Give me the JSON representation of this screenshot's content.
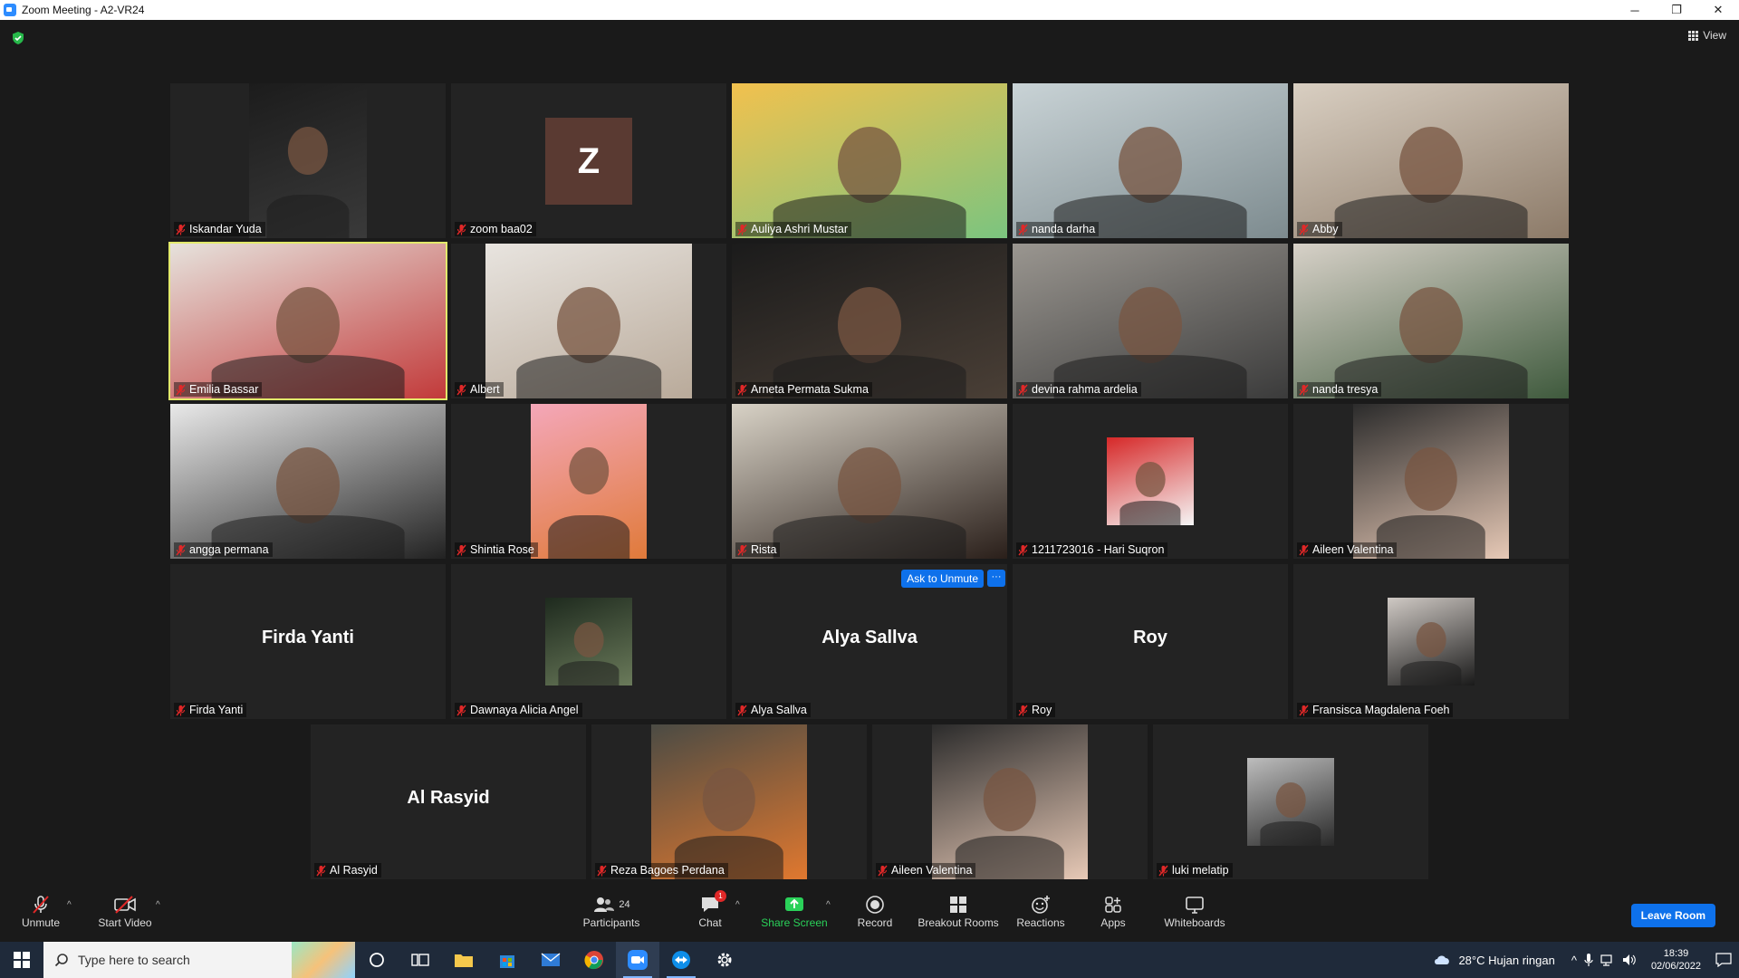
{
  "window": {
    "title": "Zoom Meeting - A2-VR24",
    "minimize": "─",
    "restore": "❐",
    "close": "✕"
  },
  "view_label": "View",
  "tiles": [
    {
      "name": "Iskandar Yuda",
      "type": "video",
      "colors": [
        "#1c1c1c",
        "#3a3a3a"
      ]
    },
    {
      "name": "zoom baa02",
      "type": "avatar",
      "initial": "Z"
    },
    {
      "name": "Auliya Ashri Mustar",
      "type": "video",
      "colors": [
        "#f2c14e",
        "#7bc47f"
      ]
    },
    {
      "name": "nanda darha",
      "type": "video",
      "colors": [
        "#c9d3d6",
        "#7d8b8f"
      ]
    },
    {
      "name": "Abby",
      "type": "video",
      "colors": [
        "#d9cfc2",
        "#8c7a68"
      ]
    },
    {
      "name": "Emilia Bassar",
      "type": "video",
      "active": true,
      "colors": [
        "#e6e2dc",
        "#c23a3a"
      ]
    },
    {
      "name": "Albert",
      "type": "video",
      "colors": [
        "#e8e4df",
        "#b9aa9a"
      ]
    },
    {
      "name": "Arneta Permata Sukma",
      "type": "video",
      "colors": [
        "#1b1b1b",
        "#4a3f36"
      ]
    },
    {
      "name": "devina rahma ardelia",
      "type": "video",
      "colors": [
        "#9a9690",
        "#3b3b3b"
      ]
    },
    {
      "name": "nanda tresya",
      "type": "video",
      "colors": [
        "#d7d1c8",
        "#3f5a3d"
      ]
    },
    {
      "name": "angga permana",
      "type": "video",
      "colors": [
        "#e9e9e9",
        "#222222"
      ]
    },
    {
      "name": "Shintia Rose",
      "type": "video",
      "colors": [
        "#f4a7b9",
        "#e07a3a"
      ]
    },
    {
      "name": "Rista",
      "type": "video",
      "colors": [
        "#d8d2c6",
        "#2a1f1a"
      ]
    },
    {
      "name": "1211723016 - Hari Suqron",
      "type": "video",
      "colors": [
        "#d62828",
        "#f5f5f5"
      ]
    },
    {
      "name": "Aileen Valentina",
      "type": "video",
      "colors": [
        "#2b2b2b",
        "#e7c9b6"
      ]
    },
    {
      "name": "Firda Yanti",
      "type": "name",
      "big": "Firda Yanti"
    },
    {
      "name": "Dawnaya Alicia Angel",
      "type": "video",
      "colors": [
        "#1e2a1e",
        "#6a7a5a"
      ]
    },
    {
      "name": "Alya Sallva",
      "type": "name",
      "big": "Alya Sallva",
      "ask": "Ask to Unmute",
      "more": "···"
    },
    {
      "name": "Roy",
      "type": "name",
      "big": "Roy"
    },
    {
      "name": "Fransisca Magdalena Foeh",
      "type": "video",
      "colors": [
        "#cfc9c4",
        "#1a1a1a"
      ]
    },
    {
      "name": "Al Rasyid",
      "type": "name",
      "big": "Al Rasyid"
    },
    {
      "name": "Reza Bagoes Perdana",
      "type": "video",
      "colors": [
        "#4b4b44",
        "#e0782f"
      ]
    },
    {
      "name": "Aileen Valentina",
      "type": "video",
      "colors": [
        "#2b2b2b",
        "#e7c9b6"
      ]
    },
    {
      "name": "luki melatip",
      "type": "video",
      "colors": [
        "#bdbdbd",
        "#2a2a2a"
      ]
    }
  ],
  "toolbar": {
    "unmute": "Unmute",
    "start_video": "Start Video",
    "participants": "Participants",
    "participants_count": "24",
    "chat": "Chat",
    "chat_badge": "1",
    "share_screen": "Share Screen",
    "record": "Record",
    "breakout_rooms": "Breakout Rooms",
    "reactions": "Reactions",
    "apps": "Apps",
    "whiteboards": "Whiteboards",
    "leave_room": "Leave Room",
    "caret": "^"
  },
  "taskbar": {
    "search_placeholder": "Type here to search",
    "weather": "28°C  Hujan ringan",
    "time": "18:39",
    "date": "02/06/2022",
    "chevron": "^"
  }
}
